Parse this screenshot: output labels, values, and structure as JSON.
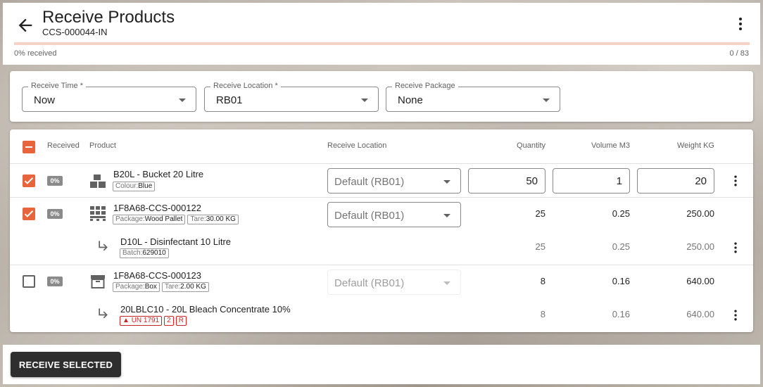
{
  "header": {
    "title": "Receive Products",
    "subtitle": "CCS-000044-IN",
    "progress_label": "0% received",
    "progress_count": "0 / 83",
    "progress_fraction": 0
  },
  "filters": {
    "receive_time": {
      "label": "Receive Time *",
      "value": "Now"
    },
    "receive_location": {
      "label": "Receive Location *",
      "value": "RB01"
    },
    "receive_package": {
      "label": "Receive Package",
      "value": "None"
    }
  },
  "table": {
    "headers": {
      "received": "Received",
      "product": "Product",
      "location": "Receive Location",
      "quantity": "Quantity",
      "volume": "Volume M3",
      "weight": "Weight KG"
    },
    "rows": [
      {
        "checked": true,
        "pct": "0%",
        "icon": "bucket-icon",
        "name": "B20L - Bucket 20 Litre",
        "chips": [
          {
            "k": "Colour:",
            "v": "Blue"
          }
        ],
        "location": "Default (RB01)",
        "quantity": "50",
        "volume": "1",
        "weight": "20"
      },
      {
        "checked": true,
        "pct": "0%",
        "icon": "pallet-icon",
        "name": "1F8A68-CCS-000122",
        "chips": [
          {
            "k": "Package:",
            "v": "Wood Pallet"
          },
          {
            "k": "Tare:",
            "v": "30.00 KG"
          }
        ],
        "location": "Default (RB01)",
        "quantity": "25",
        "volume": "0.25",
        "weight": "250.00",
        "child": {
          "name": "D10L - Disinfectant 10 Litre",
          "chips": [
            {
              "k": "Batch:",
              "v": "629010"
            }
          ],
          "quantity": "25",
          "volume": "0.25",
          "weight": "250.00"
        }
      },
      {
        "checked": false,
        "pct": "0%",
        "icon": "box-icon",
        "name": "1F8A68-CCS-000123",
        "chips": [
          {
            "k": "Package:",
            "v": "Box"
          },
          {
            "k": "Tare:",
            "v": "2.00 KG"
          }
        ],
        "location": "Default (RB01)",
        "quantity": "8",
        "volume": "0.16",
        "weight": "640.00",
        "child": {
          "name": "20LBLC10 - 20L Bleach Concentrate 10%",
          "hazard_un": "UN 1791",
          "hazard_class": "2",
          "hazard_code": "R",
          "quantity": "8",
          "volume": "0.16",
          "weight": "640.00"
        }
      }
    ]
  },
  "footer": {
    "receive_button": "RECEIVE SELECTED"
  },
  "colors": {
    "accent": "#e8643c",
    "dark": "#2e2e2e",
    "hazard": "#c62828"
  }
}
